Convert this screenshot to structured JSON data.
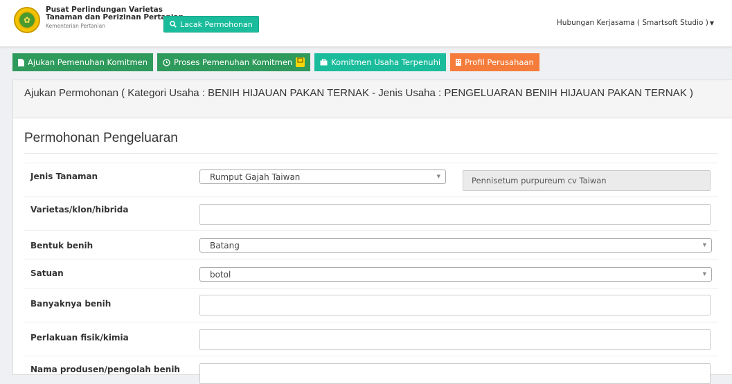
{
  "brand": {
    "line1": "Pusat Perlindungan Varietas",
    "line2": "Tanaman dan Perizinan Pertanian",
    "line3": "Kementerian Pertanian"
  },
  "header": {
    "track_button": "Lacak Permohonan",
    "user_menu": "Hubungan Kerjasama ( Smartsoft Studio )"
  },
  "tabs": [
    {
      "label": "Ajukan Pemenuhan Komitmen",
      "icon": "file-icon"
    },
    {
      "label": "Proses Pemenuhan Komitmen",
      "icon": "clock-icon",
      "badge": ""
    },
    {
      "label": "Komitmen Usaha Terpenuhi",
      "icon": "briefcase-icon"
    },
    {
      "label": "Profil Perusahaan",
      "icon": "building-icon"
    }
  ],
  "panel": {
    "heading": "Ajukan Permohonan ( Kategori Usaha : BENIH HIJAUAN PAKAN TERNAK - Jenis Usaha : PENGELUARAN BENIH HIJAUAN PAKAN TERNAK )",
    "section_title": "Permohonan Pengeluaran"
  },
  "form": {
    "jenis_tanaman": {
      "label": "Jenis Tanaman",
      "value": "Rumput Gajah Taiwan",
      "latin": "Pennisetum purpureum cv Taiwan"
    },
    "varietas": {
      "label": "Varietas/klon/hibrida",
      "value": ""
    },
    "bentuk_benih": {
      "label": "Bentuk benih",
      "value": "Batang"
    },
    "satuan": {
      "label": "Satuan",
      "value": "botol"
    },
    "banyaknya": {
      "label": "Banyaknya benih",
      "value": ""
    },
    "perlakuan": {
      "label": "Perlakuan fisik/kimia",
      "value": ""
    },
    "produsen": {
      "label": "Nama produsen/pengolah benih",
      "value": ""
    }
  },
  "colors": {
    "green": "#2e9a5c",
    "teal": "#1abc9c",
    "orange": "#f57c3b",
    "badge": "#f5d60a"
  }
}
